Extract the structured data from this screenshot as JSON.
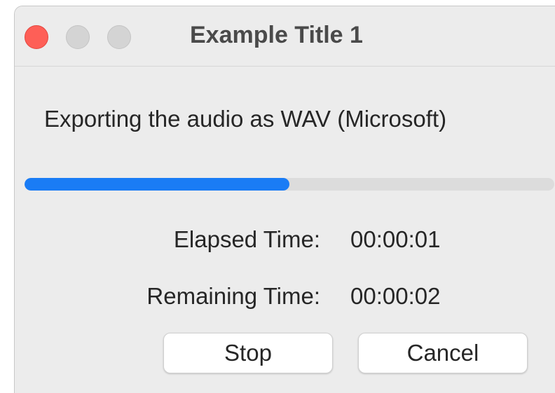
{
  "window": {
    "title": "Example Title 1"
  },
  "dialog": {
    "message": "Exporting the audio as WAV (Microsoft)",
    "progress": 0.5,
    "progress_color": "#1a7cf5",
    "elapsed_label": "Elapsed Time:",
    "elapsed_value": "00:00:01",
    "remaining_label": "Remaining Time:",
    "remaining_value": "00:00:02"
  },
  "buttons": {
    "stop_label": "Stop",
    "cancel_label": "Cancel"
  },
  "icons": {
    "close": "close-traffic-light",
    "minimize": "minimize-traffic-light",
    "zoom": "zoom-traffic-light"
  }
}
